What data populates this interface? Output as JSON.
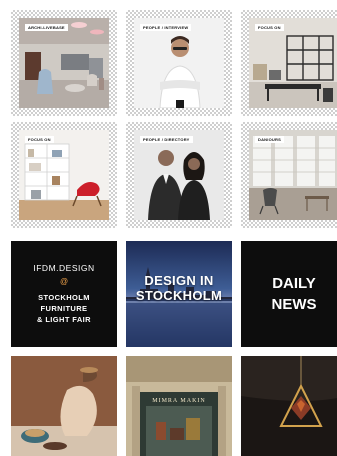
{
  "grid": {
    "tiles": [
      {
        "id": "arch",
        "tag": "ARCHI-LIVEBASE"
      },
      {
        "id": "portrait",
        "tag": "PEOPLE / INTERVIEW"
      },
      {
        "id": "shelf",
        "tag": "FOCUS ON"
      },
      {
        "id": "bookcase",
        "tag": "FOCUS ON"
      },
      {
        "id": "duo",
        "tag": "PEOPLE / DIRECTORY"
      },
      {
        "id": "room",
        "tag": "DANIOURS"
      },
      {
        "id": "ifdm",
        "lines": [
          "IFDM.DESIGN",
          "@",
          "STOCKHOLM",
          "FURNITURE",
          "& LIGHT FAIR"
        ]
      },
      {
        "id": "dis",
        "lines": [
          "DESIGN IN",
          "STOCKHOLM"
        ]
      },
      {
        "id": "daily",
        "lines": [
          "DAILY",
          "NEWS"
        ]
      },
      {
        "id": "vase"
      },
      {
        "id": "store",
        "sign": "MIMRA MAKIN"
      },
      {
        "id": "lamp"
      }
    ]
  },
  "colors": {
    "ifdm_accent": "#f0a24a",
    "tile_dark": "#0d0d0d"
  }
}
